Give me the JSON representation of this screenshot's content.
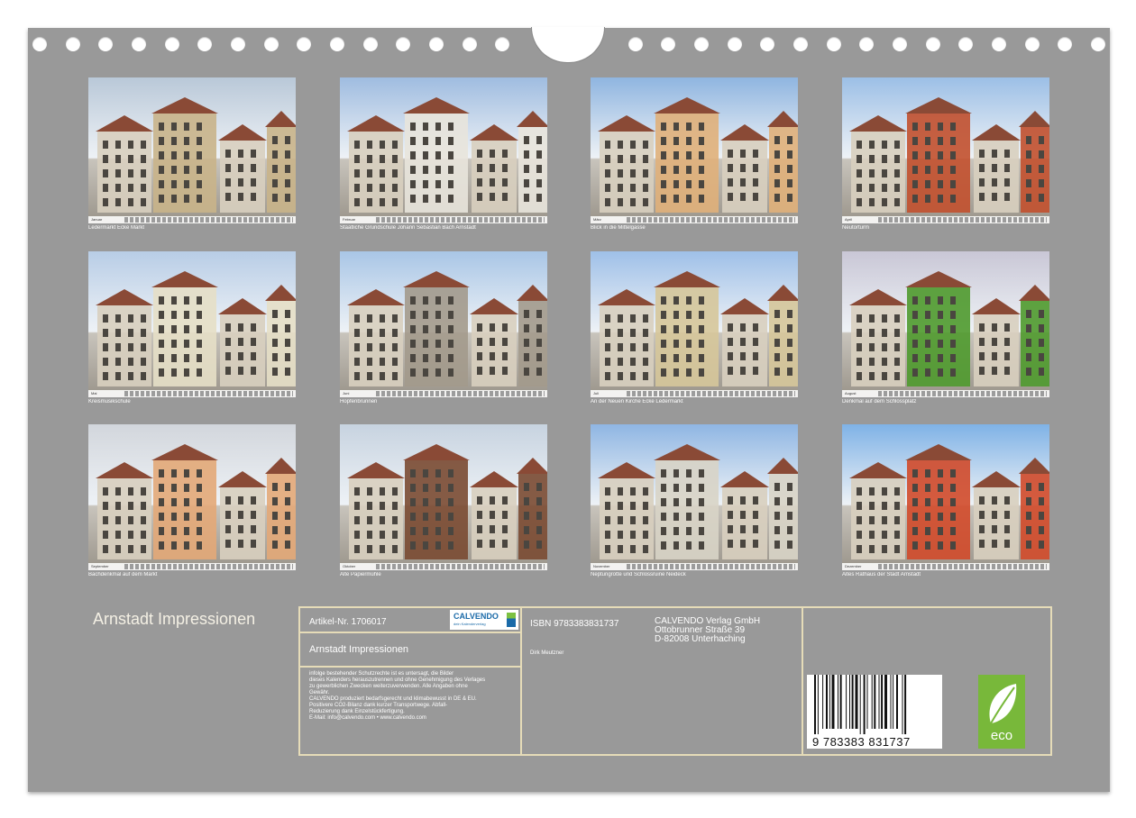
{
  "calendar": {
    "title": "Arnstadt Impressionen",
    "photos": [
      {
        "caption": "Ledermarkt Ecke Markt",
        "month": "Januar",
        "sky": "#b9c8d8",
        "accent": "#c9b48a"
      },
      {
        "caption": "Staatliche Grundschule Johann Sebastian Bach Arnstadt",
        "month": "Februar",
        "sky": "#9fbce0",
        "accent": "#e8e4dc"
      },
      {
        "caption": "Blick in die Mittelgasse",
        "month": "März",
        "sky": "#8fb5e0",
        "accent": "#e0b07a"
      },
      {
        "caption": "Neutorturm",
        "month": "April",
        "sky": "#9cbfe6",
        "accent": "#c2502e"
      },
      {
        "caption": "Kreismusikschule",
        "month": "Mai",
        "sky": "#b8cde6",
        "accent": "#e6dfc6"
      },
      {
        "caption": "Hopfenbrunnen",
        "month": "Juni",
        "sky": "#a9c6e6",
        "accent": "#a39a8c"
      },
      {
        "caption": "An der Neuen Kirche Ecke Ledermarkt",
        "month": "Juli",
        "sky": "#9fc0e8",
        "accent": "#d6c79a"
      },
      {
        "caption": "Denkmal auf dem Schlossplatz",
        "month": "August",
        "sky": "#c9c7d6",
        "accent": "#4f9a2e"
      },
      {
        "caption": "Bachdenkmal auf dem Markt",
        "month": "September",
        "sky": "#d2d6dc",
        "accent": "#e3a878"
      },
      {
        "caption": "Alte Papiermühle",
        "month": "Oktober",
        "sky": "#c7d3e0",
        "accent": "#7a4a32"
      },
      {
        "caption": "Neptungrotte und Schlossruine Neideck",
        "month": "November",
        "sky": "#8fb6e3",
        "accent": "#d8d4c6"
      },
      {
        "caption": "Altes Rathaus der Stadt Arnstadt",
        "month": "Dezember",
        "sky": "#7fb2e6",
        "accent": "#d24a2a"
      }
    ]
  },
  "info": {
    "article": "Artikel-Nr. 1706017",
    "logo_brand": "CALVENDO",
    "logo_sub": "dein Kalenderverlag",
    "product_title": "Arnstadt Impressionen",
    "notice_lines": [
      "infolge bestehender Schutzrechte ist es untersagt, die Bilder",
      "dieses Kalenders herauszutrennen und ohne Genehmigung des Verlages",
      "zu gewerblichen Zwecken weiterzuverwenden. Alle Angaben ohne",
      "Gewähr.",
      "CALVENDO produziert bedarfsgerecht und klimabewusst in DE & EU.",
      "Positivere CO2-Bilanz dank kurzer Transportwege. Abfall-",
      "Reduzierung dank Einzelstückfertigung.",
      "E-Mail: info@calvendo.com • www.calvendo.com"
    ],
    "isbn": "ISBN 9783383831737",
    "author": "Dirk Meutzner",
    "publisher_lines": [
      "CALVENDO Verlag GmbH",
      "Ottobrunner Straße 39",
      "D-82008 Unterhaching"
    ],
    "barcode_number": "9 783383 831737",
    "eco_label": "eco"
  }
}
